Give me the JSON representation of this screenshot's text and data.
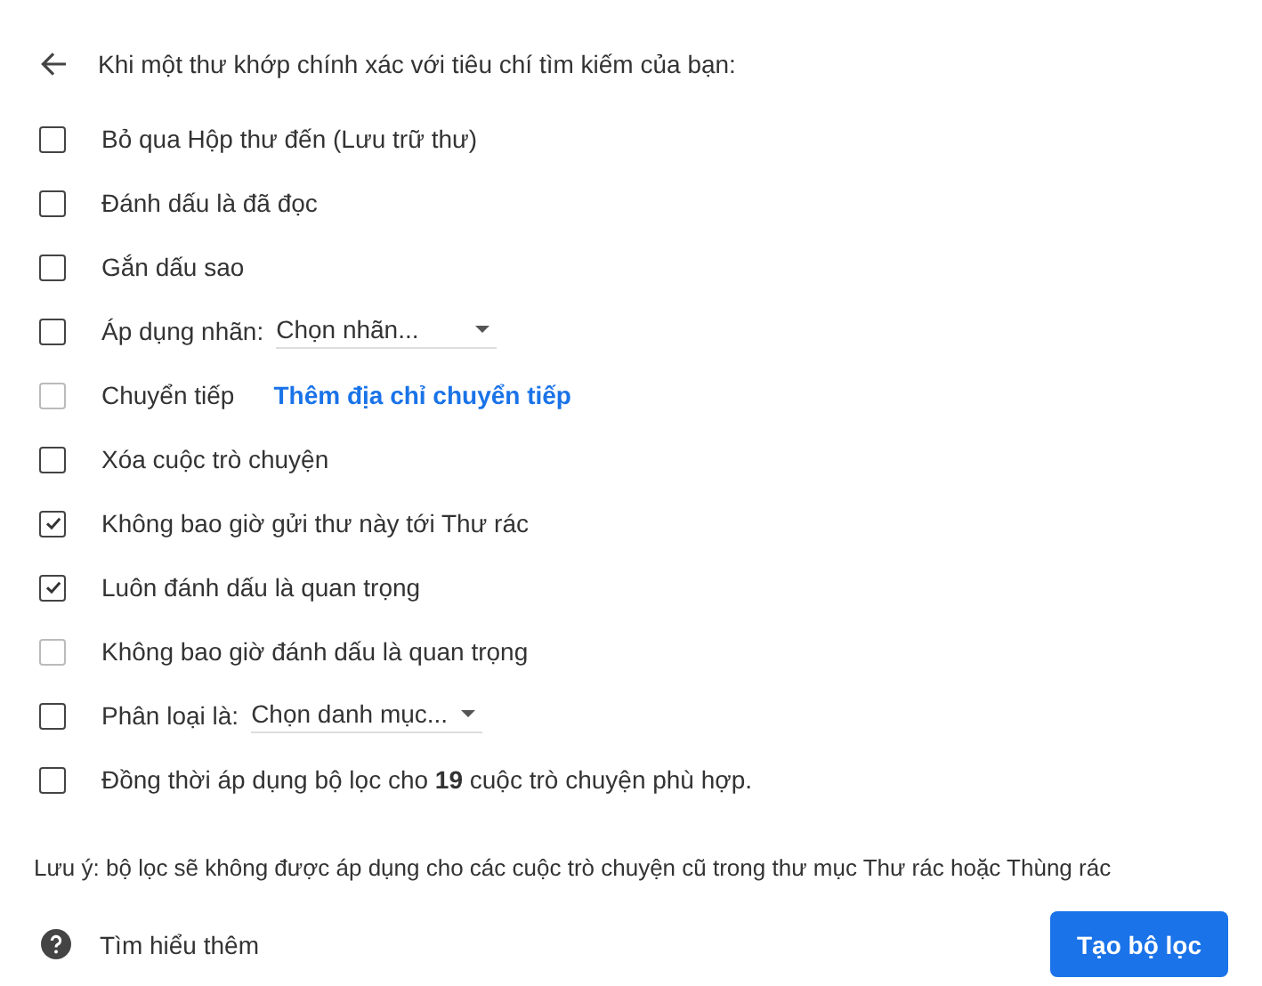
{
  "header": {
    "title": "Khi một thư khớp chính xác với tiêu chí tìm kiếm của bạn:"
  },
  "options": [
    {
      "kind": "plain",
      "label": "Bỏ qua Hộp thư đến (Lưu trữ thư)",
      "checked": false,
      "disabled": false
    },
    {
      "kind": "plain",
      "label": "Đánh dấu là đã đọc",
      "checked": false,
      "disabled": false
    },
    {
      "kind": "plain",
      "label": "Gắn dấu sao",
      "checked": false,
      "disabled": false
    },
    {
      "kind": "select",
      "label": "Áp dụng nhãn:",
      "select": "Chọn nhãn...",
      "checked": false,
      "disabled": false
    },
    {
      "kind": "link",
      "label": "Chuyển tiếp",
      "link": "Thêm địa chỉ chuyển tiếp",
      "checked": false,
      "disabled": true
    },
    {
      "kind": "plain",
      "label": "Xóa cuộc trò chuyện",
      "checked": false,
      "disabled": false
    },
    {
      "kind": "plain",
      "label": "Không bao giờ gửi thư này tới Thư rác",
      "checked": true,
      "disabled": false
    },
    {
      "kind": "plain",
      "label": "Luôn đánh dấu là quan trọng",
      "checked": true,
      "disabled": false
    },
    {
      "kind": "plain",
      "label": "Không bao giờ đánh dấu là quan trọng",
      "checked": false,
      "disabled": true
    },
    {
      "kind": "select",
      "label": "Phân loại là:",
      "select": "Chọn danh mục...",
      "checked": false,
      "disabled": false
    },
    {
      "kind": "plain",
      "label": "Đồng thời áp dụng bộ lọc cho **19** cuộc trò chuyện phù hợp.",
      "checked": false,
      "disabled": false
    }
  ],
  "note": "Lưu ý: bộ lọc sẽ không được áp dụng cho các cuộc trò chuyện cũ trong thư mục Thư rác hoặc Thùng rác",
  "footer": {
    "help_link": "Tìm hiểu thêm",
    "create_button": "Tạo bộ lọc"
  }
}
